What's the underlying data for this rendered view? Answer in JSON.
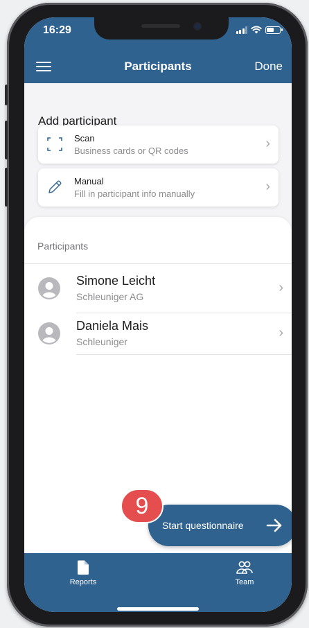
{
  "status_bar": {
    "time": "16:29",
    "battery_level": 0.6
  },
  "nav": {
    "title": "Participants",
    "done_label": "Done",
    "menu_icon": "hamburger-icon"
  },
  "add_section": {
    "title": "Add participant",
    "options": [
      {
        "title": "Scan",
        "subtitle": "Business cards or QR codes",
        "icon": "scan-frame-icon"
      },
      {
        "title": "Manual",
        "subtitle": "Fill in participant info manually",
        "icon": "pencil-icon"
      }
    ]
  },
  "participants_section": {
    "label": "Participants",
    "items": [
      {
        "name": "Simone Leicht",
        "company": "Schleuniger AG"
      },
      {
        "name": "Daniela Mais",
        "company": "Schleuniger"
      }
    ]
  },
  "fab": {
    "label": "Start questionnaire",
    "icon": "arrow-right-icon"
  },
  "step_badge": {
    "number": "9"
  },
  "tabbar": {
    "tabs": [
      {
        "label": "Reports",
        "icon": "document-icon"
      },
      {
        "label": "Team",
        "icon": "team-icon"
      }
    ]
  },
  "colors": {
    "brand": "#30628f",
    "badge": "#e54e4e"
  }
}
